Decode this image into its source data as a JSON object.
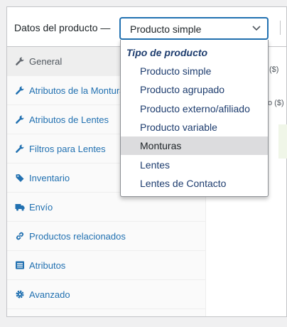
{
  "header": {
    "title": "Datos del producto —",
    "select_value": "Producto simple"
  },
  "tabs": [
    {
      "label": "General",
      "icon": "wrench-icon",
      "active": true
    },
    {
      "label": "Atributos de la Montura",
      "icon": "wrench-icon"
    },
    {
      "label": "Atributos de Lentes",
      "icon": "wrench-icon"
    },
    {
      "label": "Filtros para Lentes",
      "icon": "wrench-icon"
    },
    {
      "label": "Inventario",
      "icon": "tag-icon"
    },
    {
      "label": "Envío",
      "icon": "truck-icon"
    },
    {
      "label": "Productos relacionados",
      "icon": "link-icon"
    },
    {
      "label": "Atributos",
      "icon": "list-icon"
    },
    {
      "label": "Avanzado",
      "icon": "gear-icon"
    }
  ],
  "right_fragments": {
    "top": "($)",
    "mid": "o ($)"
  },
  "dropdown": {
    "group_label": "Tipo de producto",
    "options": [
      "Producto simple",
      "Producto agrupado",
      "Producto externo/afiliado",
      "Producto variable",
      "Monturas",
      "Lentes",
      "Lentes de Contacto"
    ],
    "highlighted": "Monturas"
  },
  "colors": {
    "link": "#2271b1",
    "option_text": "#1d3c6e",
    "highlight": "#dcdcde"
  }
}
